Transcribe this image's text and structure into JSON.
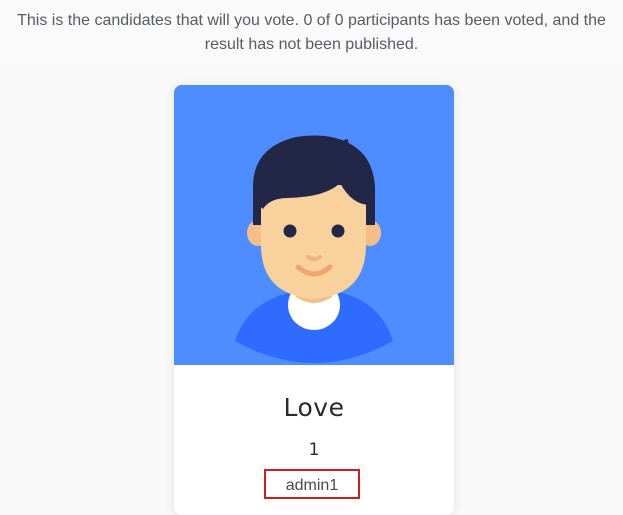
{
  "notice": {
    "text": "This is the candidates that will you vote. 0 of 0 participants has been voted, and the result has not been published."
  },
  "candidate": {
    "name": "Love",
    "number": "1",
    "username": "admin1",
    "avatar_icon": "male-avatar-icon"
  },
  "colors": {
    "card_image_bg": "#4d8dff",
    "shirt": "#2f6bff",
    "hair": "#232747",
    "skin": "#f8d19c",
    "highlight_border": "#d01c1c"
  }
}
